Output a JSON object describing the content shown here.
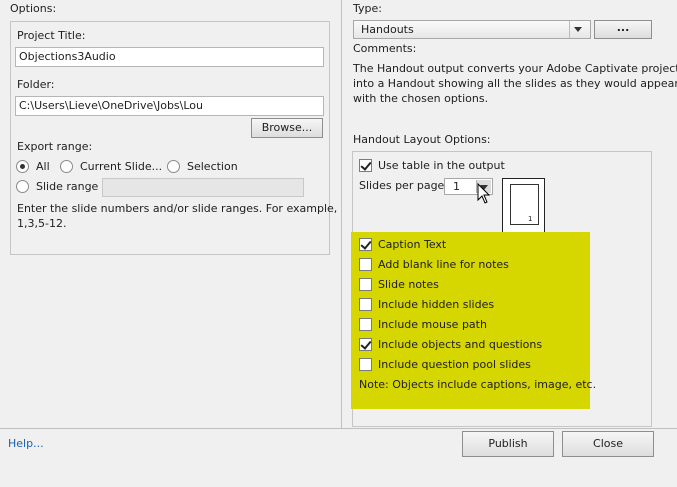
{
  "left": {
    "options_heading": "Options:",
    "project_title_label": "Project Title:",
    "project_title_value": "Objections3Audio",
    "folder_label": "Folder:",
    "folder_value": "C:\\Users\\Lieve\\OneDrive\\Jobs\\Lou",
    "browse_label": "Browse...",
    "export_range_label": "Export range:",
    "radio_all": "All",
    "radio_current": "Current Slide...",
    "radio_selection": "Selection",
    "radio_slide_range": "Slide range",
    "selected_range": "All",
    "slide_range_value": "",
    "hint_line1": "Enter the slide numbers and/or slide ranges. For example,",
    "hint_line2": "1,3,5-12."
  },
  "right": {
    "type_label": "Type:",
    "type_value": "Handouts",
    "ellipsis_label": "...",
    "comments_label": "Comments:",
    "comments_line1": "The Handout output converts your Adobe Captivate project",
    "comments_line2": "into a Handout showing all the slides as they would appear",
    "comments_line3": "with the chosen options.",
    "layout_label": "Handout Layout Options:",
    "use_table_label": "Use table in the output",
    "use_table_checked": true,
    "slides_per_page_label": "Slides per page",
    "slides_per_page_value": "1",
    "preview_page_number": "1",
    "highlight_color": "#d6d600",
    "options": [
      {
        "label": "Caption Text",
        "checked": true
      },
      {
        "label": "Add blank line for notes",
        "checked": false
      },
      {
        "label": "Slide notes",
        "checked": false
      },
      {
        "label": "Include hidden slides",
        "checked": false
      },
      {
        "label": "Include mouse path",
        "checked": false
      },
      {
        "label": "Include objects and questions",
        "checked": true
      },
      {
        "label": "Include question pool slides",
        "checked": false
      }
    ],
    "note": "Note: Objects include captions, image, etc."
  },
  "footer": {
    "help_label": "Help...",
    "publish_label": "Publish",
    "close_label": "Close"
  }
}
